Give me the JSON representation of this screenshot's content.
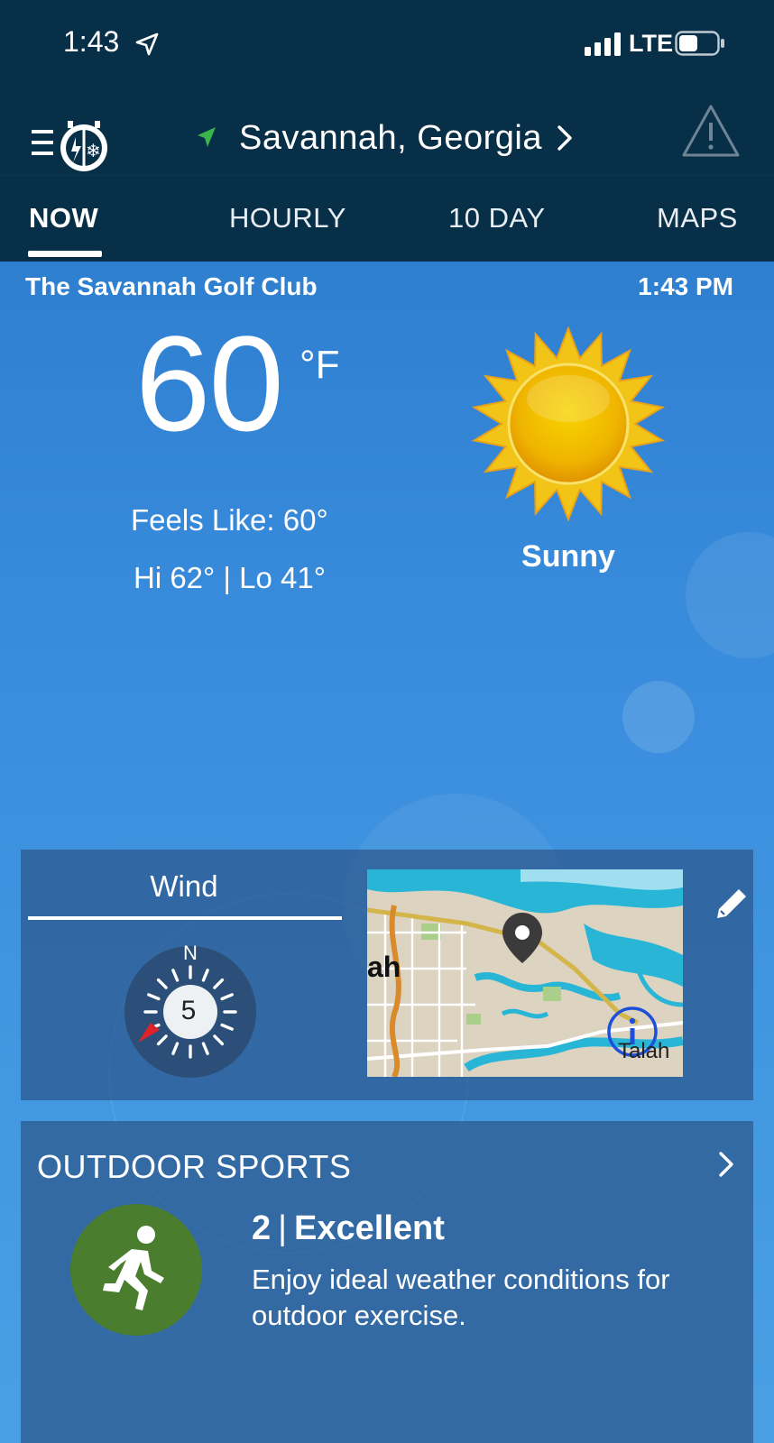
{
  "status_bar": {
    "time": "1:43",
    "network": "LTE",
    "icons": [
      "location-arrow-icon",
      "signal-icon",
      "battery-icon"
    ]
  },
  "nav": {
    "location": "Savannah,  Georgia",
    "icons": [
      "menu-icon",
      "app-logo-icon",
      "location-arrow-icon",
      "chevron-right-icon",
      "alert-icon"
    ]
  },
  "tabs": [
    {
      "label": "NOW",
      "active": true
    },
    {
      "label": "HOURLY",
      "active": false
    },
    {
      "label": "10  DAY",
      "active": false
    },
    {
      "label": "MAPS",
      "active": false
    }
  ],
  "current": {
    "station": "The Savannah Golf Club",
    "time": "1:43 PM",
    "temperature": "60",
    "unit": "°F",
    "feels_like": "Feels Like: 60°",
    "hi_lo": "Hi 62° | Lo 41°",
    "condition": "Sunny",
    "condition_icon": "sun-icon"
  },
  "wind": {
    "title": "Wind",
    "compass_label": "N",
    "speed": "5",
    "direction_icon": "wind-direction-arrow-icon"
  },
  "map": {
    "label_left": "ah",
    "label_right": "Talah",
    "icons": [
      "map-pin-icon",
      "info-icon",
      "edit-icon"
    ]
  },
  "outdoor_sports": {
    "title": "OUTDOOR SPORTS",
    "score": "2",
    "rating": "Excellent",
    "description": "Enjoy ideal weather conditions for outdoor exercise.",
    "badge_color": "#4a7d2e",
    "icon": "runner-icon"
  },
  "colors": {
    "header_bg": "#082f48",
    "sky_top": "#2f7fd0",
    "sky_bottom": "#4a9fe4",
    "card_bg": "#2c588c"
  }
}
